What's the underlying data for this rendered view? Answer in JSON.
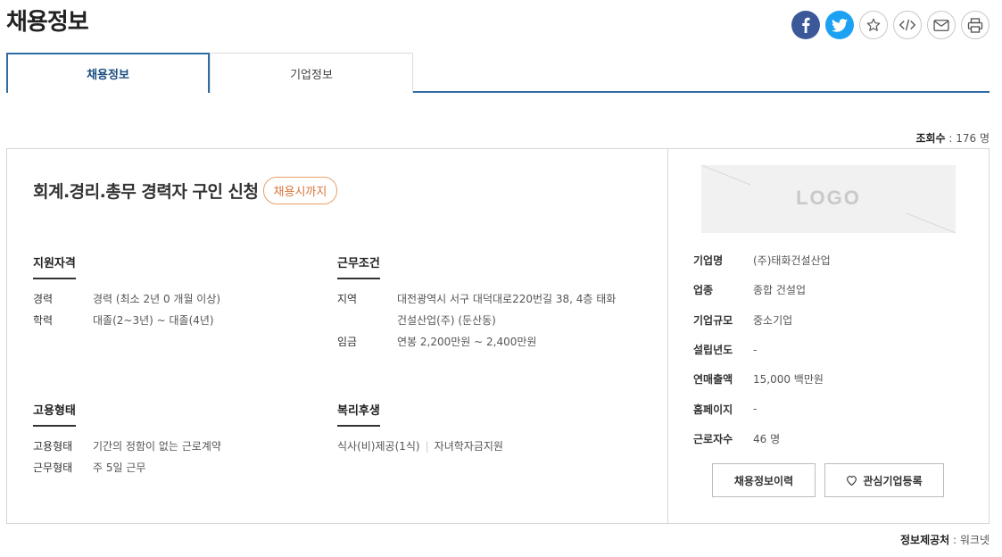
{
  "page": {
    "title": "채용정보"
  },
  "share": {
    "buttons": [
      {
        "icon": "facebook-icon"
      },
      {
        "icon": "twitter-icon"
      },
      {
        "icon": "star-icon"
      },
      {
        "icon": "code-icon"
      },
      {
        "icon": "mail-icon"
      },
      {
        "icon": "print-icon"
      }
    ]
  },
  "tabs": [
    {
      "label": "채용정보",
      "active": true
    },
    {
      "label": "기업정보",
      "active": false
    }
  ],
  "views": {
    "label": "조회수",
    "value": "176 명"
  },
  "job": {
    "title": "회계.경리.총무 경력자 구인 신청",
    "deadline": "채용시까지",
    "qualification": {
      "heading": "지원자격",
      "career_label": "경력",
      "career_value": "경력 (최소 2년 0 개월 이상)",
      "education_label": "학력",
      "education_value": "대졸(2~3년) ~ 대졸(4년)"
    },
    "conditions": {
      "heading": "근무조건",
      "region_label": "지역",
      "region_line1": "대전광역시 서구 대덕대로220번길 38, 4층 태화",
      "region_line2": "건설산업(주) (둔산동)",
      "salary_label": "임금",
      "salary_value": "연봉 2,200만원 ~ 2,400만원"
    },
    "employment": {
      "heading": "고용형태",
      "type_label": "고용형태",
      "type_value": "기간의 정함이 없는 근로계약",
      "work_label": "근무형태",
      "work_value": "주 5일 근무"
    },
    "welfare": {
      "heading": "복리후생",
      "items": [
        "식사(비)제공(1식)",
        "자녀학자금지원"
      ]
    }
  },
  "company": {
    "logo_text": "LOGO",
    "fields": [
      {
        "label": "기업명",
        "value": "(주)태화건설산업"
      },
      {
        "label": "업종",
        "value": "종합 건설업"
      },
      {
        "label": "기업규모",
        "value": "중소기업"
      },
      {
        "label": "설립년도",
        "value": "-"
      },
      {
        "label": "연매출액",
        "value": "15,000 백만원"
      },
      {
        "label": "홈페이지",
        "value": "-"
      },
      {
        "label": "근로자수",
        "value": "46 명"
      }
    ],
    "history_button": "채용정보이력",
    "favorite_button": "관심기업등록"
  },
  "source": {
    "label": "정보제공처",
    "value": "워크넷"
  }
}
